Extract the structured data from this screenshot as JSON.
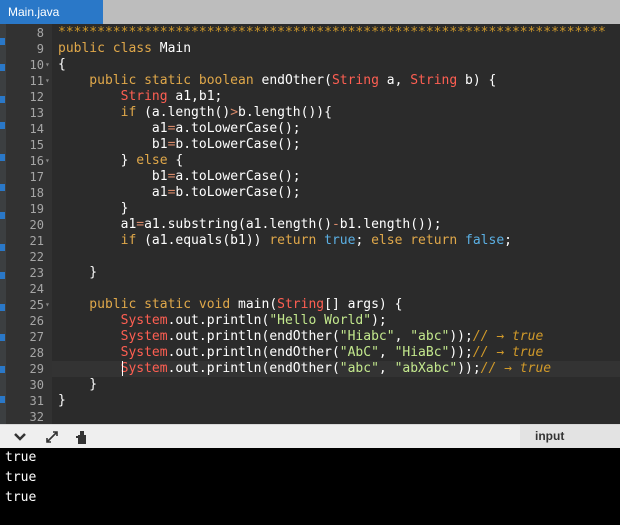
{
  "tabs": [
    {
      "label": "Main.java",
      "active": true
    }
  ],
  "editor": {
    "line_numbers": [
      "8",
      "9",
      "10",
      "11",
      "12",
      "13",
      "14",
      "15",
      "16",
      "17",
      "18",
      "19",
      "20",
      "21",
      "22",
      "23",
      "24",
      "25",
      "26",
      "27",
      "28",
      "29",
      "30",
      "31",
      "32"
    ],
    "active_line": "29",
    "lines": [
      {
        "n": "8",
        "segments": [
          {
            "t": "**********************************************************************",
            "c": "c"
          }
        ]
      },
      {
        "n": "9",
        "segments": [
          {
            "t": "public class ",
            "c": "k"
          },
          {
            "t": "Main",
            "c": "p"
          }
        ]
      },
      {
        "n": "10",
        "segments": [
          {
            "t": "{",
            "c": "p"
          }
        ]
      },
      {
        "n": "11",
        "segments": [
          {
            "t": "    public static boolean ",
            "c": "k"
          },
          {
            "t": "endOther(",
            "c": "p"
          },
          {
            "t": "String",
            "c": "t"
          },
          {
            "t": " a, ",
            "c": "p"
          },
          {
            "t": "String",
            "c": "t"
          },
          {
            "t": " b) {",
            "c": "p"
          }
        ]
      },
      {
        "n": "12",
        "segments": [
          {
            "t": "        String",
            "c": "t"
          },
          {
            "t": " a1,b1;",
            "c": "p"
          }
        ]
      },
      {
        "n": "13",
        "segments": [
          {
            "t": "        if ",
            "c": "k"
          },
          {
            "t": "(a.length()",
            "c": "p"
          },
          {
            "t": ">",
            "c": "op"
          },
          {
            "t": "b.length()){",
            "c": "p"
          }
        ]
      },
      {
        "n": "14",
        "segments": [
          {
            "t": "            a1",
            "c": "p"
          },
          {
            "t": "=",
            "c": "op"
          },
          {
            "t": "a.toLowerCase();",
            "c": "p"
          }
        ]
      },
      {
        "n": "15",
        "segments": [
          {
            "t": "            b1",
            "c": "p"
          },
          {
            "t": "=",
            "c": "op"
          },
          {
            "t": "b.toLowerCase();",
            "c": "p"
          }
        ]
      },
      {
        "n": "16",
        "segments": [
          {
            "t": "        } ",
            "c": "p"
          },
          {
            "t": "else",
            "c": "k"
          },
          {
            "t": " {",
            "c": "p"
          }
        ]
      },
      {
        "n": "17",
        "segments": [
          {
            "t": "            b1",
            "c": "p"
          },
          {
            "t": "=",
            "c": "op"
          },
          {
            "t": "a.toLowerCase();",
            "c": "p"
          }
        ]
      },
      {
        "n": "18",
        "segments": [
          {
            "t": "            a1",
            "c": "p"
          },
          {
            "t": "=",
            "c": "op"
          },
          {
            "t": "b.toLowerCase();",
            "c": "p"
          }
        ]
      },
      {
        "n": "19",
        "segments": [
          {
            "t": "        }",
            "c": "p"
          }
        ]
      },
      {
        "n": "20",
        "segments": [
          {
            "t": "        a1",
            "c": "p"
          },
          {
            "t": "=",
            "c": "op"
          },
          {
            "t": "a1.substring(a1.length()",
            "c": "p"
          },
          {
            "t": "-",
            "c": "op"
          },
          {
            "t": "b1.length());",
            "c": "p"
          }
        ]
      },
      {
        "n": "21",
        "segments": [
          {
            "t": "        if ",
            "c": "k"
          },
          {
            "t": "(a1.equals(b1)) ",
            "c": "p"
          },
          {
            "t": "return ",
            "c": "k"
          },
          {
            "t": "true",
            "c": "b"
          },
          {
            "t": "; ",
            "c": "p"
          },
          {
            "t": "else return ",
            "c": "k"
          },
          {
            "t": "false",
            "c": "b"
          },
          {
            "t": ";",
            "c": "p"
          }
        ]
      },
      {
        "n": "22",
        "segments": []
      },
      {
        "n": "23",
        "segments": [
          {
            "t": "    }",
            "c": "p"
          }
        ]
      },
      {
        "n": "24",
        "segments": []
      },
      {
        "n": "25",
        "segments": [
          {
            "t": "    public static void ",
            "c": "k"
          },
          {
            "t": "main(",
            "c": "p"
          },
          {
            "t": "String",
            "c": "t"
          },
          {
            "t": "[] args) {",
            "c": "p"
          }
        ]
      },
      {
        "n": "26",
        "segments": [
          {
            "t": "        System",
            "c": "t"
          },
          {
            "t": ".out.println(",
            "c": "p"
          },
          {
            "t": "\"Hello World\"",
            "c": "s"
          },
          {
            "t": ");",
            "c": "p"
          }
        ]
      },
      {
        "n": "27",
        "segments": [
          {
            "t": "        System",
            "c": "t"
          },
          {
            "t": ".out.println(endOther(",
            "c": "p"
          },
          {
            "t": "\"Hiabc\"",
            "c": "s"
          },
          {
            "t": ", ",
            "c": "p"
          },
          {
            "t": "\"abc\"",
            "c": "s"
          },
          {
            "t": "));",
            "c": "p"
          },
          {
            "t": "// → true",
            "c": "c"
          }
        ]
      },
      {
        "n": "28",
        "segments": [
          {
            "t": "        System",
            "c": "t"
          },
          {
            "t": ".out.println(endOther(",
            "c": "p"
          },
          {
            "t": "\"AbC\"",
            "c": "s"
          },
          {
            "t": ", ",
            "c": "p"
          },
          {
            "t": "\"HiaBc\"",
            "c": "s"
          },
          {
            "t": "));",
            "c": "p"
          },
          {
            "t": "// → true",
            "c": "c"
          }
        ]
      },
      {
        "n": "29",
        "segments": [
          {
            "t": "        System",
            "c": "t"
          },
          {
            "t": ".out.println(endOther(",
            "c": "p"
          },
          {
            "t": "\"abc\"",
            "c": "s"
          },
          {
            "t": ", ",
            "c": "p"
          },
          {
            "t": "\"abXabc\"",
            "c": "s"
          },
          {
            "t": "));",
            "c": "p"
          },
          {
            "t": "// → true",
            "c": "c"
          }
        ]
      },
      {
        "n": "30",
        "segments": [
          {
            "t": "    }",
            "c": "p"
          }
        ]
      },
      {
        "n": "31",
        "segments": [
          {
            "t": "}",
            "c": "p"
          }
        ]
      },
      {
        "n": "32",
        "segments": []
      }
    ],
    "fold_lines": [
      "10",
      "11",
      "16",
      "25"
    ]
  },
  "console_toolbar": {
    "icons": [
      "chevron-down-icon",
      "expand-icon",
      "clear-console-icon"
    ],
    "input_label": "input"
  },
  "console": {
    "output_lines": [
      "true",
      "true",
      "true"
    ]
  },
  "colors": {
    "tab_active": "#2a78c8",
    "editor_bg": "#2b2b2b",
    "keyword": "#e0a84a",
    "type": "#ff5f52",
    "string": "#c3e88d",
    "boolean": "#5bb0e4",
    "comment": "#d19a2a"
  }
}
